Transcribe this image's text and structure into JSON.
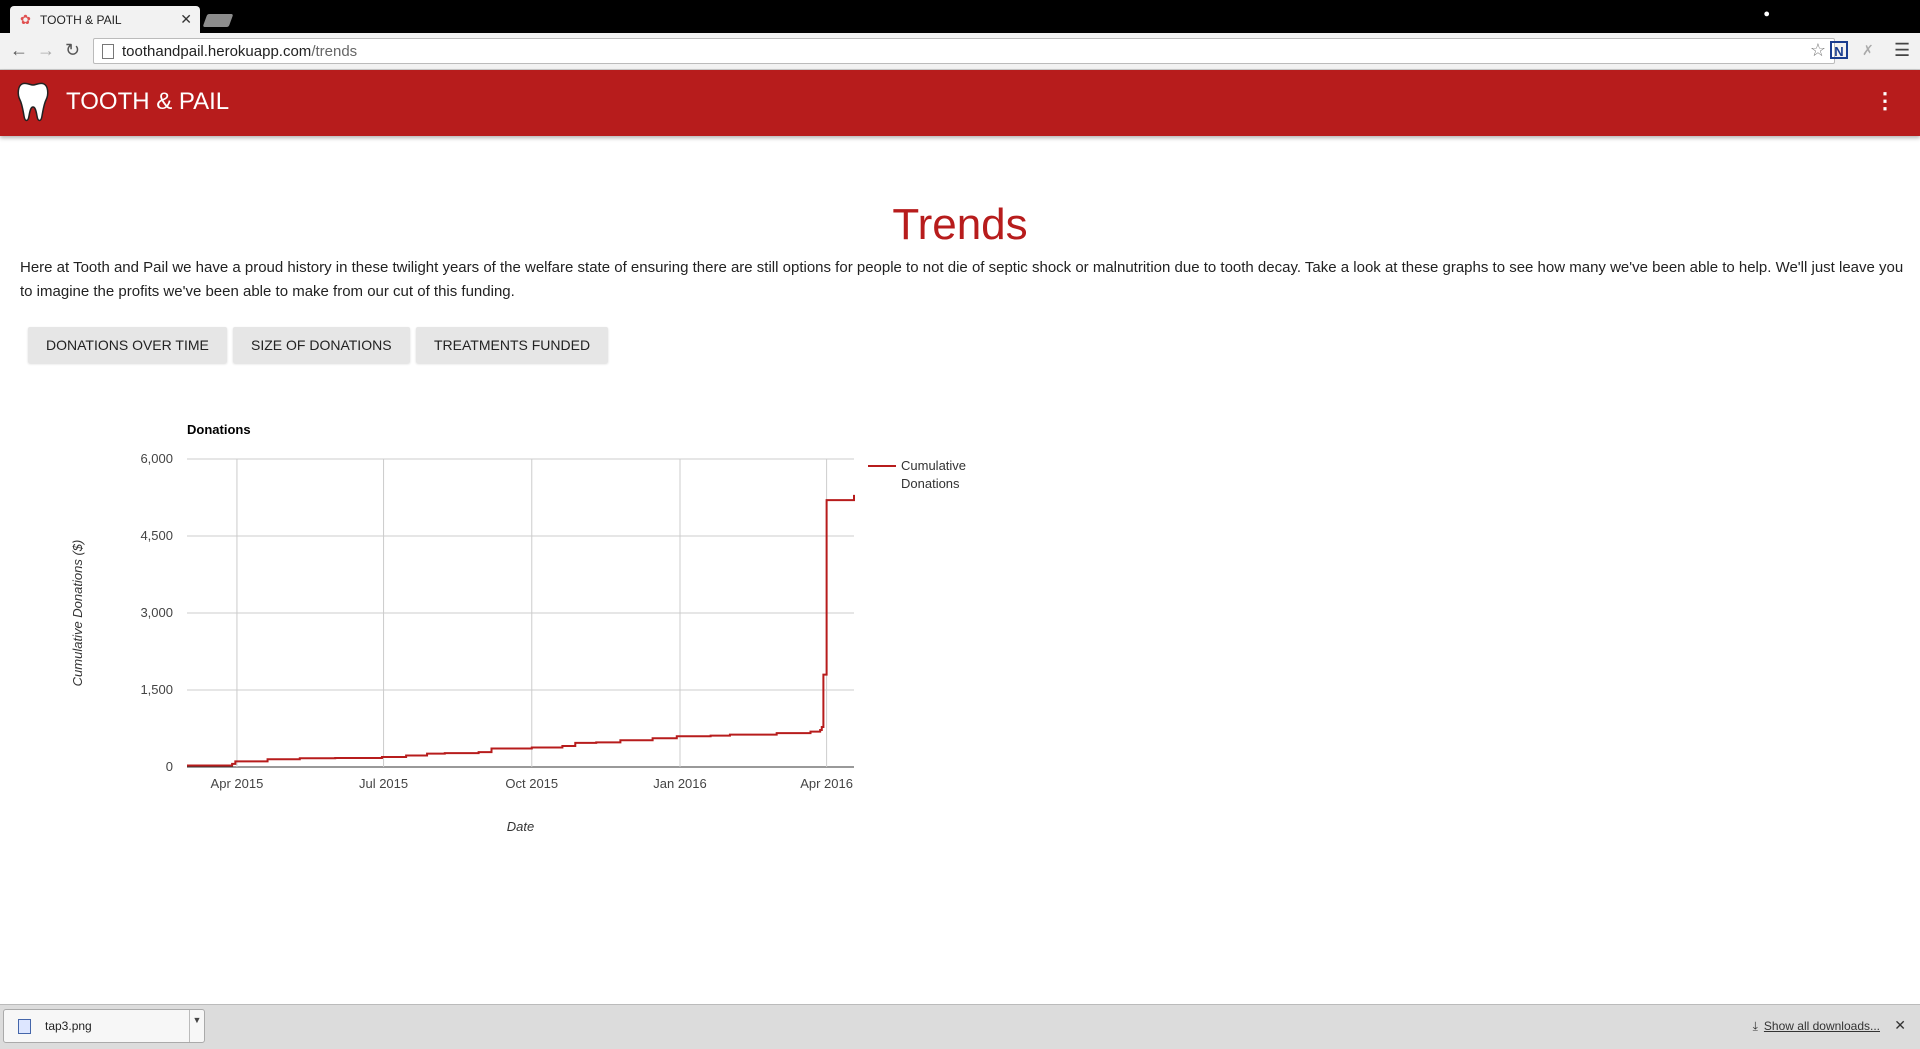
{
  "browser": {
    "tab_title": "TOOTH & PAIL",
    "url_host": "toothandpail.herokuapp.com",
    "url_path": "/trends"
  },
  "header": {
    "brand": "TOOTH & PAIL",
    "brand_color": "#b71c1c"
  },
  "main": {
    "title": "Trends",
    "intro": "Here at Tooth and Pail we have a proud history in these twilight years of the welfare state of ensuring there are still options for people to not die of septic shock or malnutrition due to tooth decay. Take a look at these graphs to see how many we've been able to help. We'll just leave you to imagine the profits we've been able to make from our cut of this funding.",
    "buttons": [
      "DONATIONS OVER TIME",
      "SIZE OF DONATIONS",
      "TREATMENTS FUNDED"
    ]
  },
  "chart_data": {
    "type": "line",
    "title": "Donations",
    "xlabel": "Date",
    "ylabel": "Cumulative Donations ($)",
    "ylim": [
      0,
      6000
    ],
    "yticks": [
      "0",
      "1,500",
      "3,000",
      "4,500",
      "6,000"
    ],
    "xticks": [
      {
        "date": "2015-04-01",
        "label": "Apr 2015"
      },
      {
        "date": "2015-07-01",
        "label": "Jul 2015"
      },
      {
        "date": "2015-10-01",
        "label": "Oct 2015"
      },
      {
        "date": "2016-01-01",
        "label": "Jan 2016"
      },
      {
        "date": "2016-04-01",
        "label": "Apr 2016"
      }
    ],
    "xlim": [
      "2015-03-01",
      "2016-04-18"
    ],
    "grid": true,
    "legend_position": "right",
    "series": [
      {
        "name": "Cumulative Donations",
        "color": "#b71c1c",
        "x": [
          "2015-03-01",
          "2015-03-29",
          "2015-03-31",
          "2015-04-20",
          "2015-05-10",
          "2015-06-01",
          "2015-06-30",
          "2015-07-15",
          "2015-07-28",
          "2015-08-08",
          "2015-08-29",
          "2015-09-06",
          "2015-10-01",
          "2015-10-20",
          "2015-10-28",
          "2015-11-10",
          "2015-11-25",
          "2015-12-15",
          "2015-12-25",
          "2015-12-30",
          "2016-01-10",
          "2016-01-20",
          "2016-02-01",
          "2016-03-01",
          "2016-03-22",
          "2016-03-28",
          "2016-03-29",
          "2016-03-30",
          "2016-04-01",
          "2016-04-18"
        ],
        "y": [
          30,
          60,
          110,
          150,
          170,
          175,
          195,
          225,
          260,
          270,
          290,
          360,
          380,
          410,
          470,
          480,
          520,
          560,
          560,
          600,
          600,
          610,
          630,
          660,
          690,
          720,
          780,
          1800,
          5200,
          5300
        ]
      }
    ]
  },
  "downloads": {
    "file_name": "tap3.png",
    "show_all": "Show all downloads..."
  }
}
